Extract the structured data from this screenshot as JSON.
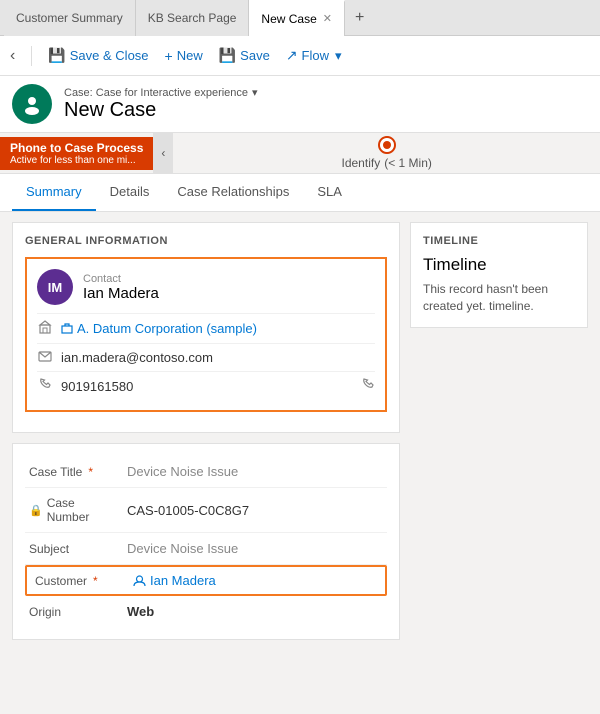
{
  "tabs": [
    {
      "id": "customer-summary",
      "label": "Customer Summary",
      "active": false,
      "closeable": false
    },
    {
      "id": "kb-search-page",
      "label": "KB Search Page",
      "active": false,
      "closeable": false
    },
    {
      "id": "new-case",
      "label": "New Case",
      "active": true,
      "closeable": true
    }
  ],
  "toolbar": {
    "back_label": "‹",
    "save_close_label": "Save & Close",
    "new_label": "New",
    "save_label": "Save",
    "flow_label": "Flow",
    "flow_chevron": "▾"
  },
  "page_header": {
    "avatar_initials": "🔒",
    "avatar_icon": "👤",
    "subtitle": "Case: Case for Interactive experience",
    "subtitle_chevron": "▾",
    "title": "New Case"
  },
  "process_bar": {
    "label_title": "Phone to Case Process",
    "label_sub": "Active for less than one mi...",
    "collapse_icon": "‹",
    "step_label": "Identify",
    "step_time": "(< 1 Min)"
  },
  "nav_tabs": [
    {
      "id": "summary",
      "label": "Summary",
      "active": true
    },
    {
      "id": "details",
      "label": "Details",
      "active": false
    },
    {
      "id": "case-relationships",
      "label": "Case Relationships",
      "active": false
    },
    {
      "id": "sla",
      "label": "SLA",
      "active": false
    }
  ],
  "general_info": {
    "section_title": "GENERAL INFORMATION",
    "contact": {
      "avatar_initials": "IM",
      "label": "Contact",
      "name": "Ian Madera",
      "company_icon": "🏢",
      "company_name": "A. Datum Corporation (sample)",
      "email_icon": "✉",
      "email": "ian.madera@contoso.com",
      "phone_icon": "📞",
      "phone": "9019161580",
      "phone_end_icon": "📞"
    }
  },
  "case_form": {
    "fields": [
      {
        "id": "case-title",
        "label": "Case Title",
        "required": true,
        "lock": false,
        "value": "Device Noise Issue",
        "type": "text",
        "placeholder": false,
        "link": false,
        "bold": false
      },
      {
        "id": "case-number",
        "label": "Case Number",
        "required": false,
        "lock": true,
        "value": "CAS-01005-C0C8G7",
        "type": "text",
        "placeholder": false,
        "link": false,
        "bold": false
      },
      {
        "id": "subject",
        "label": "Subject",
        "required": false,
        "lock": false,
        "value": "Device Noise Issue",
        "type": "text",
        "placeholder": true,
        "link": false,
        "bold": false
      },
      {
        "id": "customer",
        "label": "Customer",
        "required": true,
        "lock": false,
        "value": "Ian Madera",
        "type": "link",
        "placeholder": false,
        "link": true,
        "bold": false,
        "highlighted": true
      },
      {
        "id": "origin",
        "label": "Origin",
        "required": false,
        "lock": false,
        "value": "Web",
        "type": "text",
        "placeholder": false,
        "link": false,
        "bold": true
      }
    ]
  },
  "timeline": {
    "section_title": "TIMELINE",
    "heading": "Timeline",
    "empty_text": "This record hasn't been created yet. timeline."
  }
}
